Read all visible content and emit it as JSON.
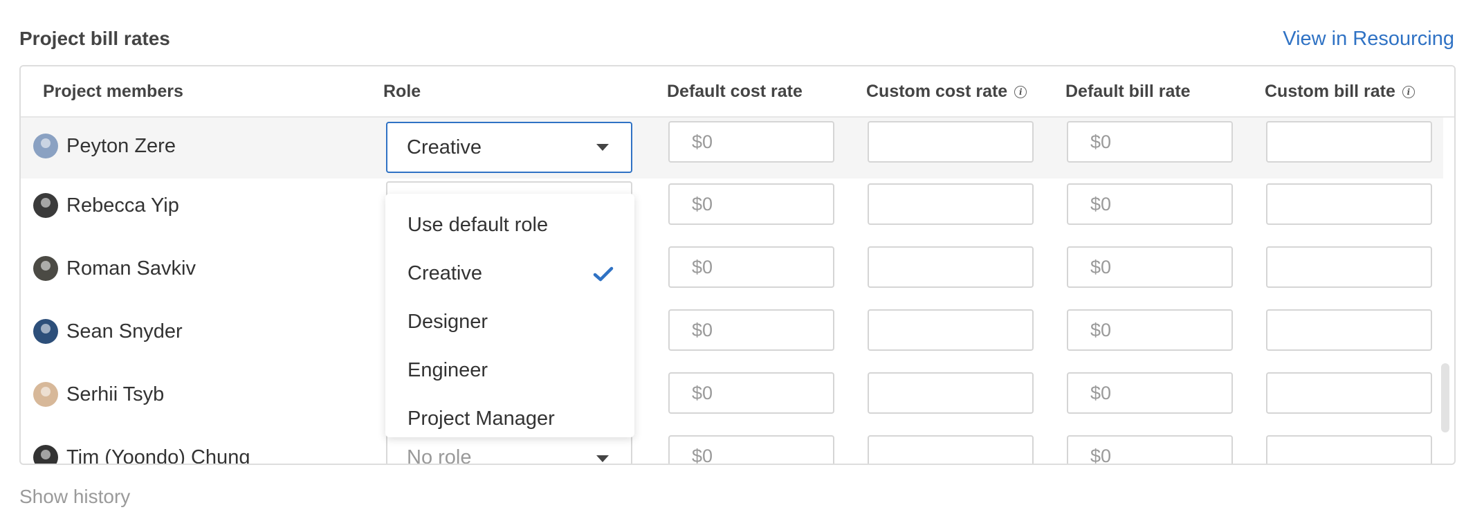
{
  "header": {
    "title": "Project bill rates",
    "view_link": "View in Resourcing"
  },
  "columns": {
    "members": "Project members",
    "role": "Role",
    "default_cost": "Default cost rate",
    "custom_cost": "Custom cost rate",
    "default_bill": "Default bill rate",
    "custom_bill": "Custom bill rate"
  },
  "rows": [
    {
      "name": "Peyton Zere",
      "role": "Creative",
      "default_cost": "$0",
      "custom_cost": "",
      "default_bill": "$0",
      "custom_bill": "",
      "avatar_color": "#8aa1c2"
    },
    {
      "name": "Rebecca Yip",
      "role": "",
      "default_cost": "$0",
      "custom_cost": "",
      "default_bill": "$0",
      "custom_bill": "",
      "avatar_color": "#3a3a3a"
    },
    {
      "name": "Roman Savkiv",
      "role": "",
      "default_cost": "$0",
      "custom_cost": "",
      "default_bill": "$0",
      "custom_bill": "",
      "avatar_color": "#4b4a44"
    },
    {
      "name": "Sean Snyder",
      "role": "",
      "default_cost": "$0",
      "custom_cost": "",
      "default_bill": "$0",
      "custom_bill": "",
      "avatar_color": "#2d4f7a"
    },
    {
      "name": "Serhii Tsyb",
      "role": "",
      "default_cost": "$0",
      "custom_cost": "",
      "default_bill": "$0",
      "custom_bill": "",
      "avatar_color": "#d7b899"
    },
    {
      "name": "Tim (Yoondo) Chung",
      "role": "No role",
      "default_cost": "$0",
      "custom_cost": "",
      "default_bill": "$0",
      "custom_bill": "",
      "avatar_color": "#333333"
    }
  ],
  "dropdown": {
    "options": [
      "Use default role",
      "Creative",
      "Designer",
      "Engineer",
      "Project Manager"
    ],
    "selected": "Creative"
  },
  "footer": {
    "history_link": "Show history"
  },
  "colors": {
    "accent": "#2f72c4",
    "selected_row": "#f5f5f5"
  }
}
